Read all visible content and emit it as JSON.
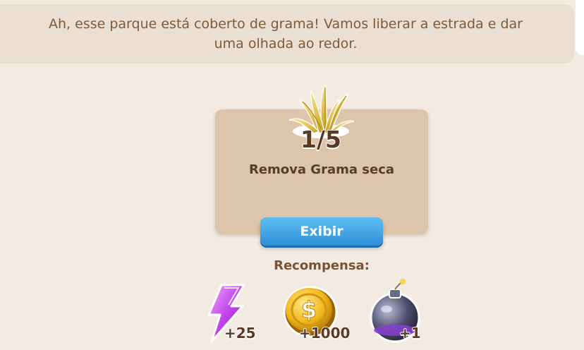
{
  "dialog": {
    "line1": "Ah, esse parque está coberto de grama! Vamos liberar a estrada e dar",
    "line2": "uma olhada ao redor."
  },
  "quest": {
    "icon": "dry-grass-icon",
    "progress_text": "1/5",
    "progress": {
      "current": 1,
      "total": 5
    },
    "task": "Remova Grama seca",
    "button_label": "Exibir"
  },
  "rewards": {
    "title": "Recompensa:",
    "items": [
      {
        "icon": "energy-bolt-icon",
        "amount": "+25"
      },
      {
        "icon": "gold-coin-icon",
        "amount": "+1000"
      },
      {
        "icon": "bomb-icon",
        "amount": "+1"
      }
    ]
  },
  "colors": {
    "background": "#f3ebe1",
    "card": "#dcc5aa",
    "button": "#3a9be3",
    "text": "#7d5a3c"
  }
}
